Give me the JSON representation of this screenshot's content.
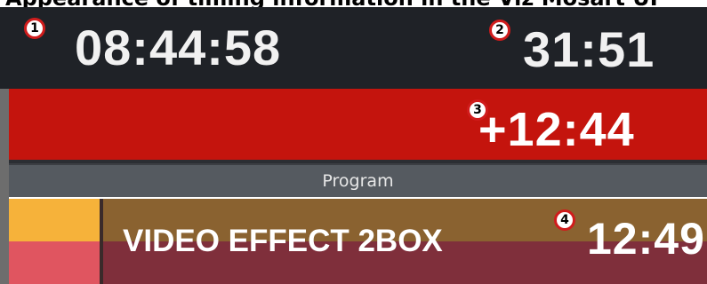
{
  "caption": "Appearance of timing information in the Viz Mosart UI",
  "timing": {
    "clock": "08:44:58",
    "remaining": "31:51",
    "over_under": "+12:44"
  },
  "program": {
    "label": "Program",
    "item": {
      "title": "VIDEO EFFECT 2BOX",
      "duration": "12:49"
    }
  },
  "markers": [
    "1",
    "2",
    "3",
    "4"
  ],
  "colors": {
    "top_bar": "#1f2227",
    "over_bar": "#c4140d",
    "program_bar": "#555a60",
    "swatch_top": "#f6b23a",
    "swatch_bottom": "#e05560",
    "item_top": "#8a6230",
    "item_bottom": "#7f2f3b",
    "marker_ring": "#d01c1c"
  }
}
